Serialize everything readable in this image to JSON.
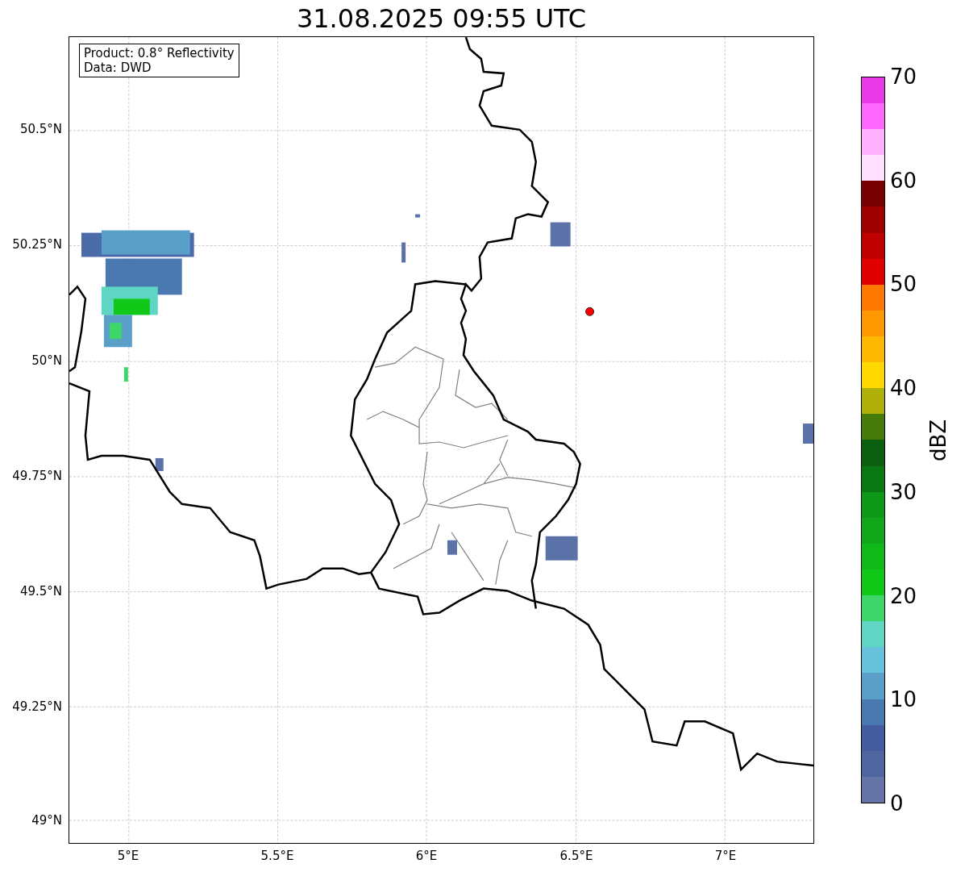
{
  "title": "31.08.2025 09:55 UTC",
  "info_box": [
    "Product: 0.8° Reflectivity",
    "Data: DWD"
  ],
  "map": {
    "yticks": [
      "50.5°N",
      "50.25°N",
      "50°N",
      "49.75°N",
      "49.5°N",
      "49.25°N",
      "49°N"
    ],
    "xticks": [
      "5°E",
      "5.5°E",
      "6°E",
      "6.5°E",
      "7°E"
    ]
  },
  "colorbar": {
    "label": "dBZ",
    "tick_labels": [
      "70",
      "60",
      "50",
      "40",
      "30",
      "20",
      "10",
      "0"
    ],
    "segments": [
      {
        "color": "#6474a6"
      },
      {
        "color": "#5066a0"
      },
      {
        "color": "#435da0"
      },
      {
        "color": "#4a78b0"
      },
      {
        "color": "#5a9fc8"
      },
      {
        "color": "#67c3dc"
      },
      {
        "color": "#5fd6c4"
      },
      {
        "color": "#3cd66a"
      },
      {
        "color": "#10c818"
      },
      {
        "color": "#10b818"
      },
      {
        "color": "#10a818"
      },
      {
        "color": "#0e9818"
      },
      {
        "color": "#0a7812"
      },
      {
        "color": "#0a600e"
      },
      {
        "color": "#467a0a"
      },
      {
        "color": "#b0b00a"
      },
      {
        "color": "#ffd800"
      },
      {
        "color": "#ffb800"
      },
      {
        "color": "#ff9800"
      },
      {
        "color": "#ff7800"
      },
      {
        "color": "#e00000"
      },
      {
        "color": "#c00000"
      },
      {
        "color": "#a00000"
      },
      {
        "color": "#780000"
      },
      {
        "color": "#ffe0ff"
      },
      {
        "color": "#ffb0ff"
      },
      {
        "color": "#ff68ff"
      },
      {
        "color": "#e838e8"
      }
    ]
  }
}
